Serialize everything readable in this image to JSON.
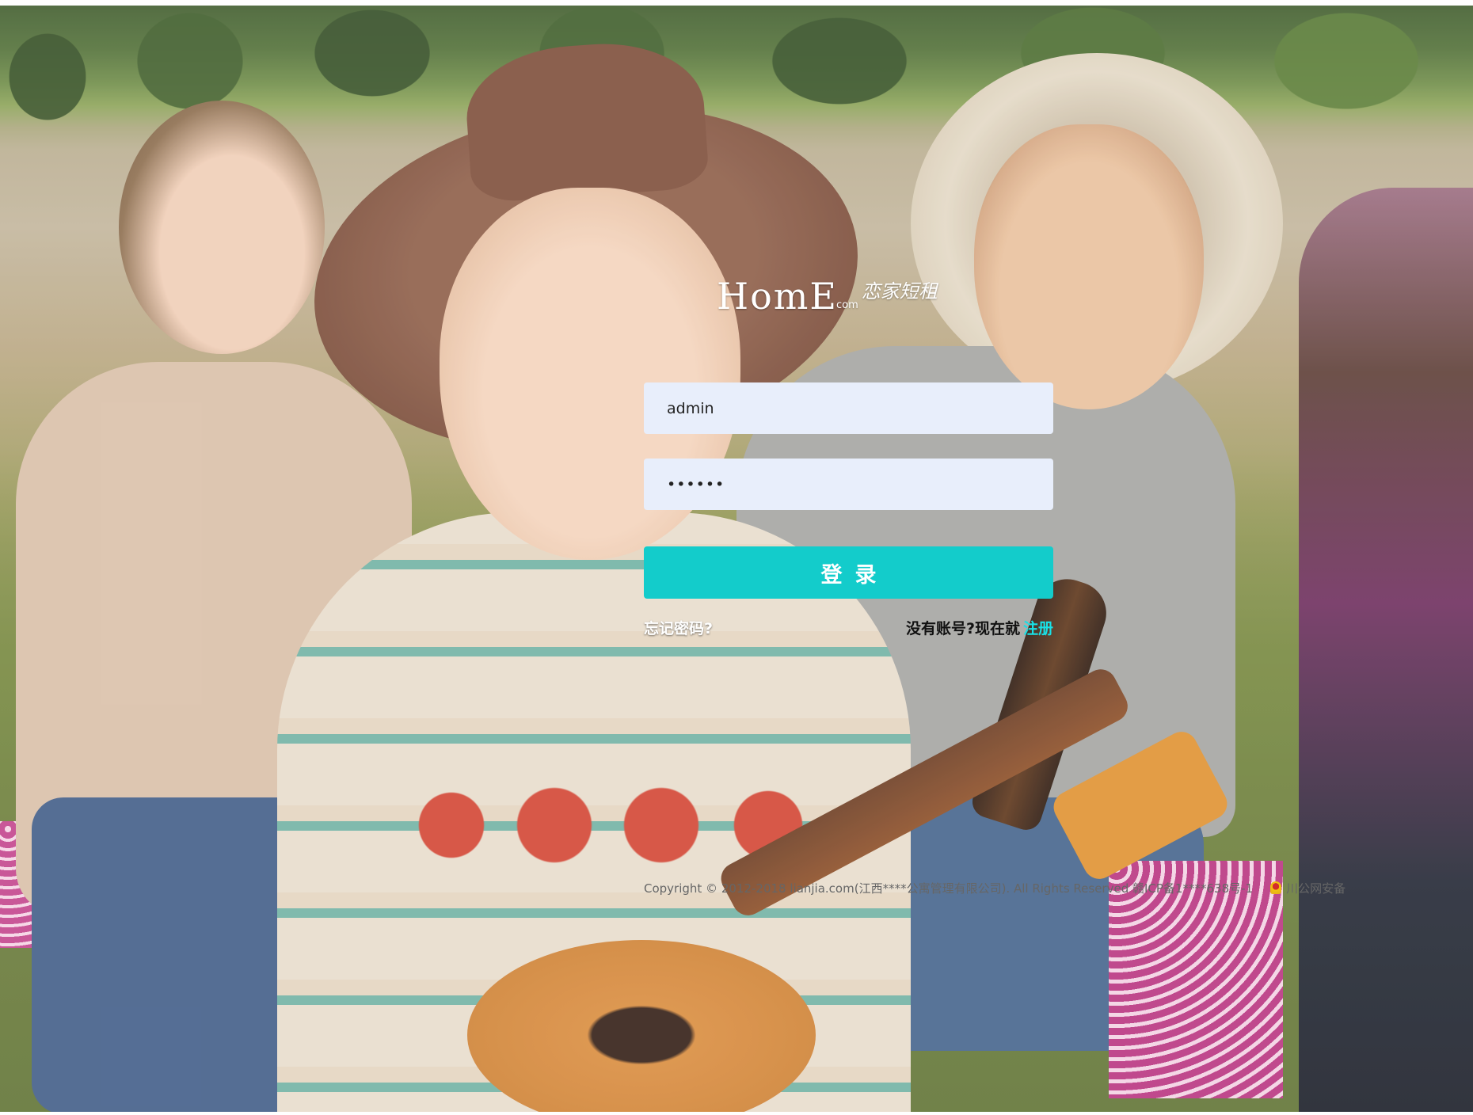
{
  "logo": {
    "brand": "HomE",
    "dotcom": "com",
    "cn": "恋家短租"
  },
  "login_form": {
    "username_value": "admin",
    "username_placeholder": "",
    "password_value": "••••••",
    "login_button": "登录",
    "forgot_password": "忘记密码?",
    "register_prompt": "没有账号?现在就",
    "register_link": "注册"
  },
  "footer": {
    "copyright": "Copyright © 2012-2018 lianjia.com(江西****公寓管理有限公司). All Rights Reserved 赣ICP备1****638号-1",
    "police_icon": "police-badge-icon",
    "police_text": "川公网安备"
  },
  "colors": {
    "accent": "#13cccb",
    "register_link": "#19e0e6",
    "field_bg": "#e8eefb"
  }
}
